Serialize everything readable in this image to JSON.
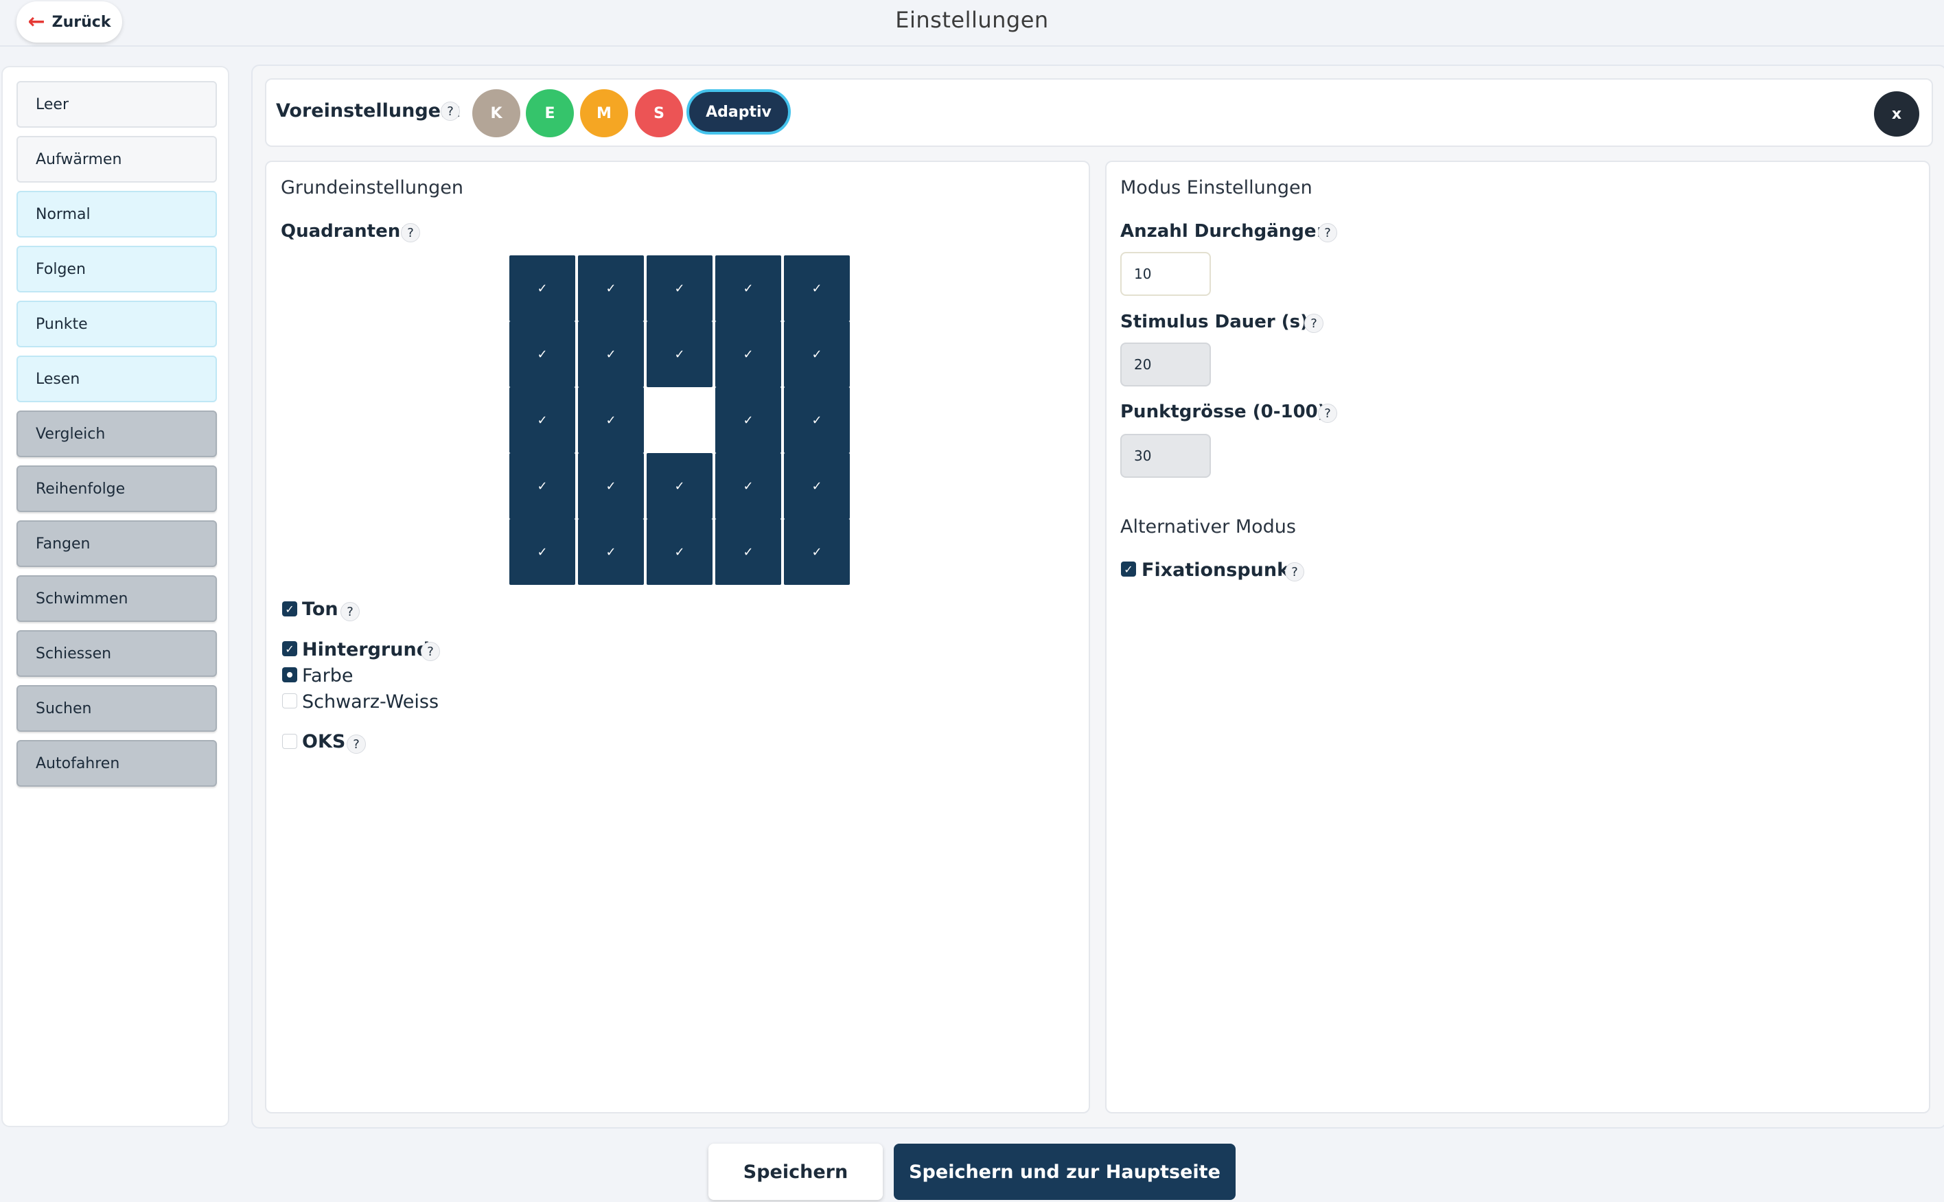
{
  "header": {
    "back_label": "Zurück",
    "title": "Einstellungen"
  },
  "sidebar": {
    "items": [
      {
        "label": "Leer",
        "style": "white"
      },
      {
        "label": "Aufwärmen",
        "style": "white"
      },
      {
        "label": "Normal",
        "style": "blue"
      },
      {
        "label": "Folgen",
        "style": "blue"
      },
      {
        "label": "Punkte",
        "style": "blue"
      },
      {
        "label": "Lesen",
        "style": "blue"
      },
      {
        "label": "Vergleich",
        "style": "gray"
      },
      {
        "label": "Reihenfolge",
        "style": "gray"
      },
      {
        "label": "Fangen",
        "style": "gray"
      },
      {
        "label": "Schwimmen",
        "style": "gray"
      },
      {
        "label": "Schiessen",
        "style": "gray"
      },
      {
        "label": "Suchen",
        "style": "gray"
      },
      {
        "label": "Autofahren",
        "style": "gray"
      }
    ]
  },
  "presets": {
    "label": "Voreinstellungen:",
    "help": "?",
    "options": [
      {
        "label": "K",
        "color": "#b3a597"
      },
      {
        "label": "E",
        "color": "#35c46b"
      },
      {
        "label": "M",
        "color": "#f5a623"
      },
      {
        "label": "S",
        "color": "#ec5455"
      }
    ],
    "active_label": "Adaptiv",
    "close_label": "x"
  },
  "basic": {
    "title": "Grundeinstellungen",
    "quadrants_label": "Quadranten:",
    "help": "?",
    "grid": {
      "rows": 5,
      "cols": 5,
      "check": "✓",
      "cells": [
        [
          true,
          true,
          true,
          true,
          true
        ],
        [
          true,
          true,
          true,
          true,
          true
        ],
        [
          true,
          true,
          false,
          true,
          true
        ],
        [
          true,
          true,
          true,
          true,
          true
        ],
        [
          true,
          true,
          true,
          true,
          true
        ]
      ]
    },
    "sound": {
      "label": "Ton",
      "checked": true
    },
    "background": {
      "label": "Hintergrund",
      "checked": true
    },
    "color_option": {
      "label": "Farbe",
      "selected": true
    },
    "bw_option": {
      "label": "Schwarz-Weiss",
      "selected": false
    },
    "oks": {
      "label": "OKS",
      "checked": false
    }
  },
  "mode": {
    "title": "Modus Einstellungen",
    "passes_label": "Anzahl Durchgänge:",
    "passes_value": "10",
    "stimulus_label": "Stimulus Dauer (s):",
    "stimulus_value": "20",
    "dot_size_label": "Punktgrösse (0-100):",
    "dot_size_value": "30",
    "alt_title": "Alternativer Modus",
    "fixation_label": "Fixationspunkt",
    "fixation_checked": true,
    "help": "?"
  },
  "footer": {
    "save_label": "Speichern",
    "save_home_label": "Speichern und zur Hauptseite"
  },
  "icons": {
    "back_arrow": "arrow-left-icon",
    "check": "check-icon"
  }
}
